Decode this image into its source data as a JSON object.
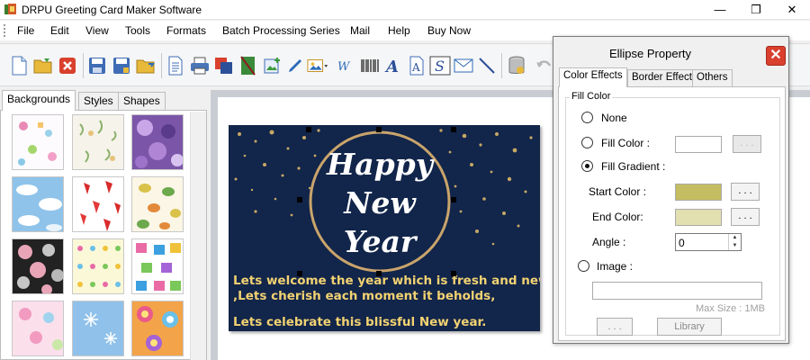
{
  "window": {
    "title": "DRPU Greeting Card Maker Software",
    "minimize": "—",
    "maximize": "❐",
    "close": "✕"
  },
  "menu": [
    "File",
    "Edit",
    "View",
    "Tools",
    "Formats",
    "Batch Processing Series",
    "Mail",
    "Help",
    "Buy Now"
  ],
  "toolbar_icons": [
    "new-icon",
    "open-icon",
    "close-doc-icon",
    "save-icon",
    "save-as-icon",
    "export-icon",
    "properties-icon",
    "print-icon",
    "copy-icon",
    "delete-icon",
    "image-icon",
    "pen-icon",
    "picture-icon",
    "watermark-icon",
    "barcode-icon",
    "text-icon",
    "word-art-icon",
    "signature-icon",
    "email-icon",
    "line-icon",
    "database-icon",
    "undo-icon"
  ],
  "left_panel": {
    "tabs": [
      "Backgrounds",
      "Styles",
      "Shapes"
    ],
    "active_tab": "Backgrounds",
    "thumbnails": [
      "thumb-1",
      "thumb-2",
      "thumb-3",
      "thumb-4",
      "thumb-5",
      "thumb-6",
      "thumb-7",
      "thumb-8",
      "thumb-9",
      "thumb-10",
      "thumb-11",
      "thumb-12"
    ]
  },
  "card": {
    "happy": "Happy",
    "new": "New",
    "year": "Year",
    "line1": "Lets welcome the year which is fresh and new",
    "line2": ",Lets cherish each moment it beholds,",
    "line3": "Lets celebrate this blissful New year.",
    "background_color": "#12254a",
    "text_color": "#f2d272",
    "ring_color": "#c9a46b"
  },
  "dialog": {
    "title": "Ellipse Property",
    "tabs": [
      "Color Effects",
      "Border Effect",
      "Others"
    ],
    "active_tab": "Color Effects",
    "group_label": "Fill Color",
    "opt_none": "None",
    "opt_fill_color": "Fill Color :",
    "opt_fill_gradient": "Fill Gradient :",
    "selected_option": "Fill Gradient",
    "start_color_label": "Start Color :",
    "end_color_label": "End Color:",
    "angle_label": "Angle :",
    "angle_value": "0",
    "opt_image": "Image :",
    "max_size": "Max Size : 1MB",
    "browse_label": ". . .",
    "library_label": "Library",
    "dots_label": ". . .",
    "start_color": "#c4bd62",
    "end_color": "#e2dfb0",
    "fill_color": "#ffffff"
  }
}
